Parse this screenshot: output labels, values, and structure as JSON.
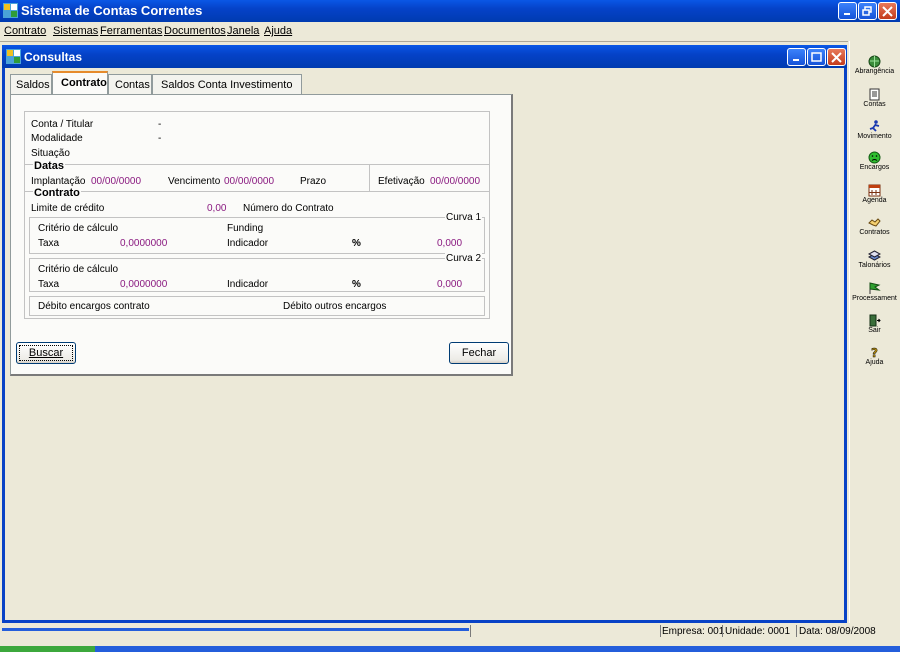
{
  "app": {
    "title": "Sistema de Contas Correntes"
  },
  "menu": [
    {
      "label": "Contrato"
    },
    {
      "label": "Sistemas"
    },
    {
      "label": "Ferramentas"
    },
    {
      "label": "Documentos"
    },
    {
      "label": "Janela"
    },
    {
      "label": "Ajuda"
    }
  ],
  "window": {
    "title": "Consultas"
  },
  "tabs": [
    {
      "label": "Saldos"
    },
    {
      "label": "Contrato"
    },
    {
      "label": "Contas"
    },
    {
      "label": "Saldos Conta Investimento"
    }
  ],
  "form": {
    "conta_titular_label": "Conta / Titular",
    "conta_titular_value": "-",
    "modalidade_label": "Modalidade",
    "modalidade_value": "-",
    "situacao_label": "Situação",
    "datas_header": "Datas",
    "implantacao_label": "Implantação",
    "implantacao_value": "00/00/0000",
    "vencimento_label": "Vencimento",
    "vencimento_value": "00/00/0000",
    "prazo_label": "Prazo",
    "efetivacao_label": "Efetivação",
    "efetivacao_value": "00/00/0000",
    "contrato_header": "Contrato",
    "limite_label": "Limite de crédito",
    "limite_value": "0,00",
    "numero_contrato_label": "Número do Contrato",
    "curva1": {
      "title": "Curva 1",
      "criterio_label": "Critério de cálculo",
      "funding_label": "Funding",
      "taxa_label": "Taxa",
      "taxa_value": "0,0000000",
      "indicador_label": "Indicador",
      "percent_symbol": "%",
      "indicador_value": "0,000"
    },
    "curva2": {
      "title": "Curva 2",
      "criterio_label": "Critério de cálculo",
      "taxa_label": "Taxa",
      "taxa_value": "0,0000000",
      "indicador_label": "Indicador",
      "percent_symbol": "%",
      "indicador_value": "0,000"
    },
    "debito_encargos_label": "Débito encargos contrato",
    "debito_outros_label": "Débito outros encargos"
  },
  "buttons": {
    "buscar": "Buscar",
    "fechar": "Fechar"
  },
  "toolbar": [
    {
      "label": "Abrangência",
      "icon": "globe-icon"
    },
    {
      "label": "Contas",
      "icon": "document-icon"
    },
    {
      "label": "Movimento",
      "icon": "runner-icon"
    },
    {
      "label": "Encargos",
      "icon": "sad-face-icon"
    },
    {
      "label": "Agenda",
      "icon": "calendar-icon"
    },
    {
      "label": "Contratos",
      "icon": "handshake-icon"
    },
    {
      "label": "Talonários",
      "icon": "stack-icon"
    },
    {
      "label": "Processament",
      "icon": "flag-icon"
    },
    {
      "label": "Sair",
      "icon": "exit-door-icon"
    },
    {
      "label": "Ajuda",
      "icon": "question-icon"
    }
  ],
  "status": {
    "empresa": "Empresa: 001",
    "unidade": "Unidade: 0001",
    "data": "Data:  08/09/2008"
  },
  "colors": {
    "titlebar": "#0842c6",
    "value_text": "#8a1a80",
    "window_bg": "#ece9d8"
  }
}
